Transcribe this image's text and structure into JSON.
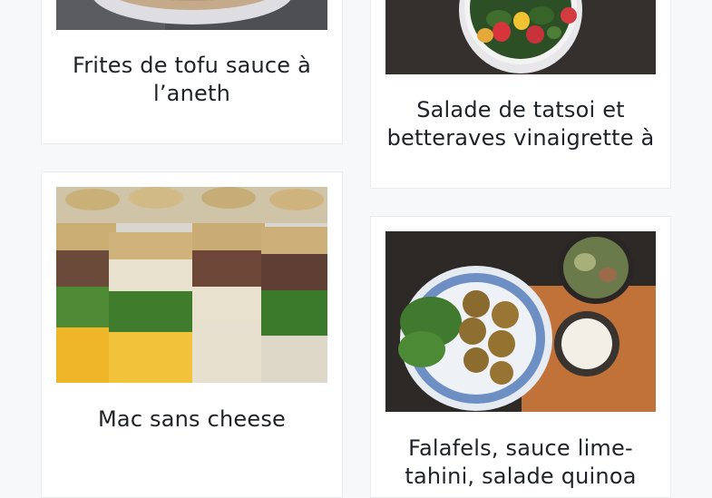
{
  "cards": [
    {
      "title": "Frites de tofu sauce à l’aneth",
      "image": "bowl-of-grains-photo"
    },
    {
      "title": "Salade de tatsoi et betteraves vinaigrette à",
      "image": "salad-bowl-photo"
    },
    {
      "title": "Mac sans cheese",
      "image": "mason-jar-pasta-salads-photo"
    },
    {
      "title": "Falafels, sauce lime-tahini, salade quinoa",
      "image": "falafel-plate-photo"
    }
  ],
  "colors": {
    "background": "#f7f8fa",
    "card": "#ffffff",
    "title": "#1f2227"
  }
}
